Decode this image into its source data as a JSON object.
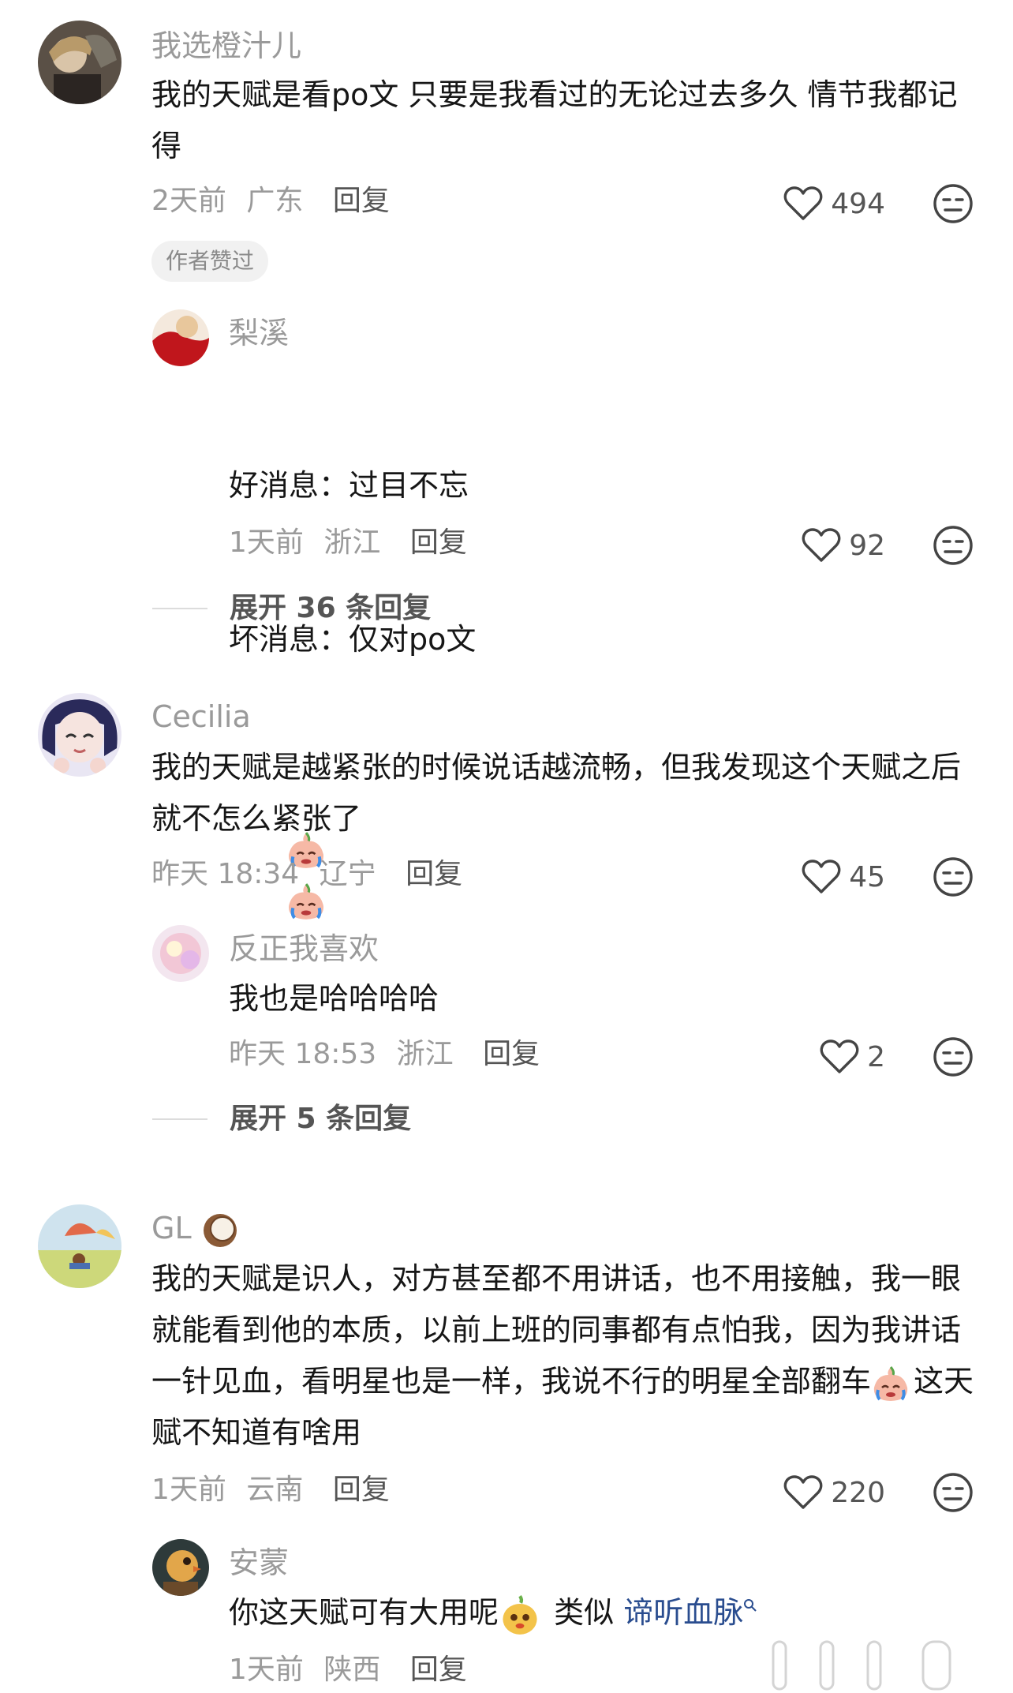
{
  "comments": [
    {
      "username": "我选橙汁儿",
      "text": "我的天赋是看po文 只要是我看过的无论过去多久 情节我都记得",
      "time": "2天前",
      "location": "广东",
      "reply_label": "回复",
      "likes": "494",
      "author_liked_label": "作者赞过",
      "reply": {
        "username": "梨溪",
        "text_line1": "好消息：过目不忘",
        "text_line2": "坏消息：仅对po文",
        "time": "1天前",
        "location": "浙江",
        "reply_label": "回复",
        "likes": "92"
      },
      "expand_label": "展开 36 条回复"
    },
    {
      "username": "Cecilia",
      "text": "我的天赋是越紧张的时候说话越流畅，但我发现这个天赋之后就不怎么紧张了",
      "time": "昨天 18:34",
      "location": "辽宁",
      "reply_label": "回复",
      "likes": "45",
      "reply": {
        "username": "反正我喜欢",
        "text": "我也是哈哈哈哈",
        "time": "昨天 18:53",
        "location": "浙江",
        "reply_label": "回复",
        "likes": "2"
      },
      "expand_label": "展开 5 条回复"
    },
    {
      "username": "GL",
      "text_before_emoji": "我的天赋是识人，对方甚至都不用讲话，也不用接触，我一眼就能看到他的本质，以前上班的同事都有点怕我，因为我讲话一针见血，看明星也是一样，我说不行的明星全部翻车",
      "text_after_emoji": "这天赋不知道有啥用",
      "time": "1天前",
      "location": "云南",
      "reply_label": "回复",
      "likes": "220",
      "reply": {
        "username": "安蒙",
        "text_before_emoji": "你这天赋可有大用呢",
        "text_middle": " 类似 ",
        "link_text": "谛听血脉",
        "time": "1天前",
        "location": "陕西",
        "reply_label": "回复"
      }
    }
  ],
  "icons": {
    "heart": "heart-outline-icon",
    "dislike": "meh-face-icon",
    "emoji_cry": "crying-peach-emoji",
    "emoji_coconut": "coconut-emoji",
    "search_small": "search-icon"
  },
  "colors": {
    "muted": "#9a9a9a",
    "text": "#161616",
    "link": "#2a4d8f"
  }
}
